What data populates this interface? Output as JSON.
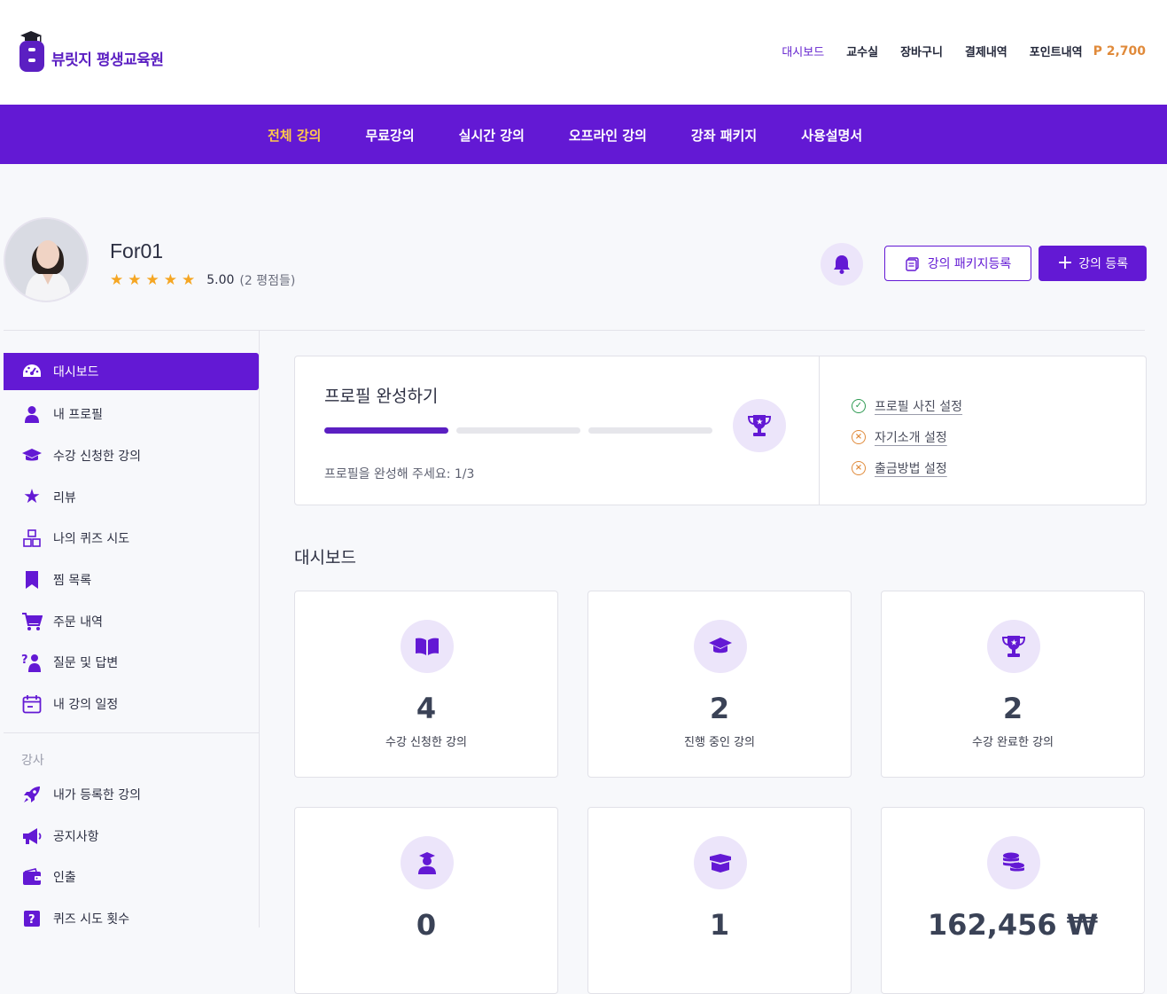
{
  "brand": {
    "name": "뷰릿지 평생교육원"
  },
  "top_links": [
    "대시보드",
    "교수실",
    "장바구니",
    "결제내역",
    "포인트내역"
  ],
  "points": "P 2,700",
  "nav": [
    "전체 강의",
    "무료강의",
    "실시간 강의",
    "오프라인 강의",
    "강좌 패키지",
    "사용설명서"
  ],
  "profile": {
    "name": "For01",
    "score": "5.00",
    "rating_count": "(2 평점들)",
    "stars": 5
  },
  "buttons": {
    "package": "강의 패키지등록",
    "add": "강의 등록"
  },
  "sidebar": {
    "items": [
      "대시보드",
      "내 프로필",
      "수강 신청한 강의",
      "리뷰",
      "나의 퀴즈 시도",
      "찜 목록",
      "주문 내역",
      "질문 및 답변",
      "내 강의 일정"
    ],
    "section": "강사",
    "instructor_items": [
      "내가 등록한 강의",
      "공지사항",
      "인출",
      "퀴즈 시도 횟수"
    ]
  },
  "profile_card": {
    "title": "프로필 완성하기",
    "progress_text": "프로필을 완성해 주세요: 1/3",
    "progress_done": 1,
    "progress_total": 3,
    "checks": [
      {
        "label": "프로필 사진 설정",
        "done": true
      },
      {
        "label": "자기소개 설정",
        "done": false
      },
      {
        "label": "출금방법 설정",
        "done": false
      }
    ]
  },
  "dashboard": {
    "title": "대시보드",
    "stats": [
      {
        "value": "4",
        "label": "수강 신청한 강의",
        "icon": "book-icon"
      },
      {
        "value": "2",
        "label": "진행 중인 강의",
        "icon": "graduation-cap-icon"
      },
      {
        "value": "2",
        "label": "수강 완료한 강의",
        "icon": "trophy-icon"
      },
      {
        "value": "0",
        "label": "",
        "icon": "student-icon"
      },
      {
        "value": "1",
        "label": "",
        "icon": "box-icon"
      },
      {
        "value": "162,456 ₩",
        "label": "",
        "icon": "coins-icon"
      }
    ]
  },
  "colors": {
    "primary": "#6319d4",
    "accent": "#ffc94a",
    "points": "#e08a3a",
    "icon_bg": "#ece5fa"
  }
}
